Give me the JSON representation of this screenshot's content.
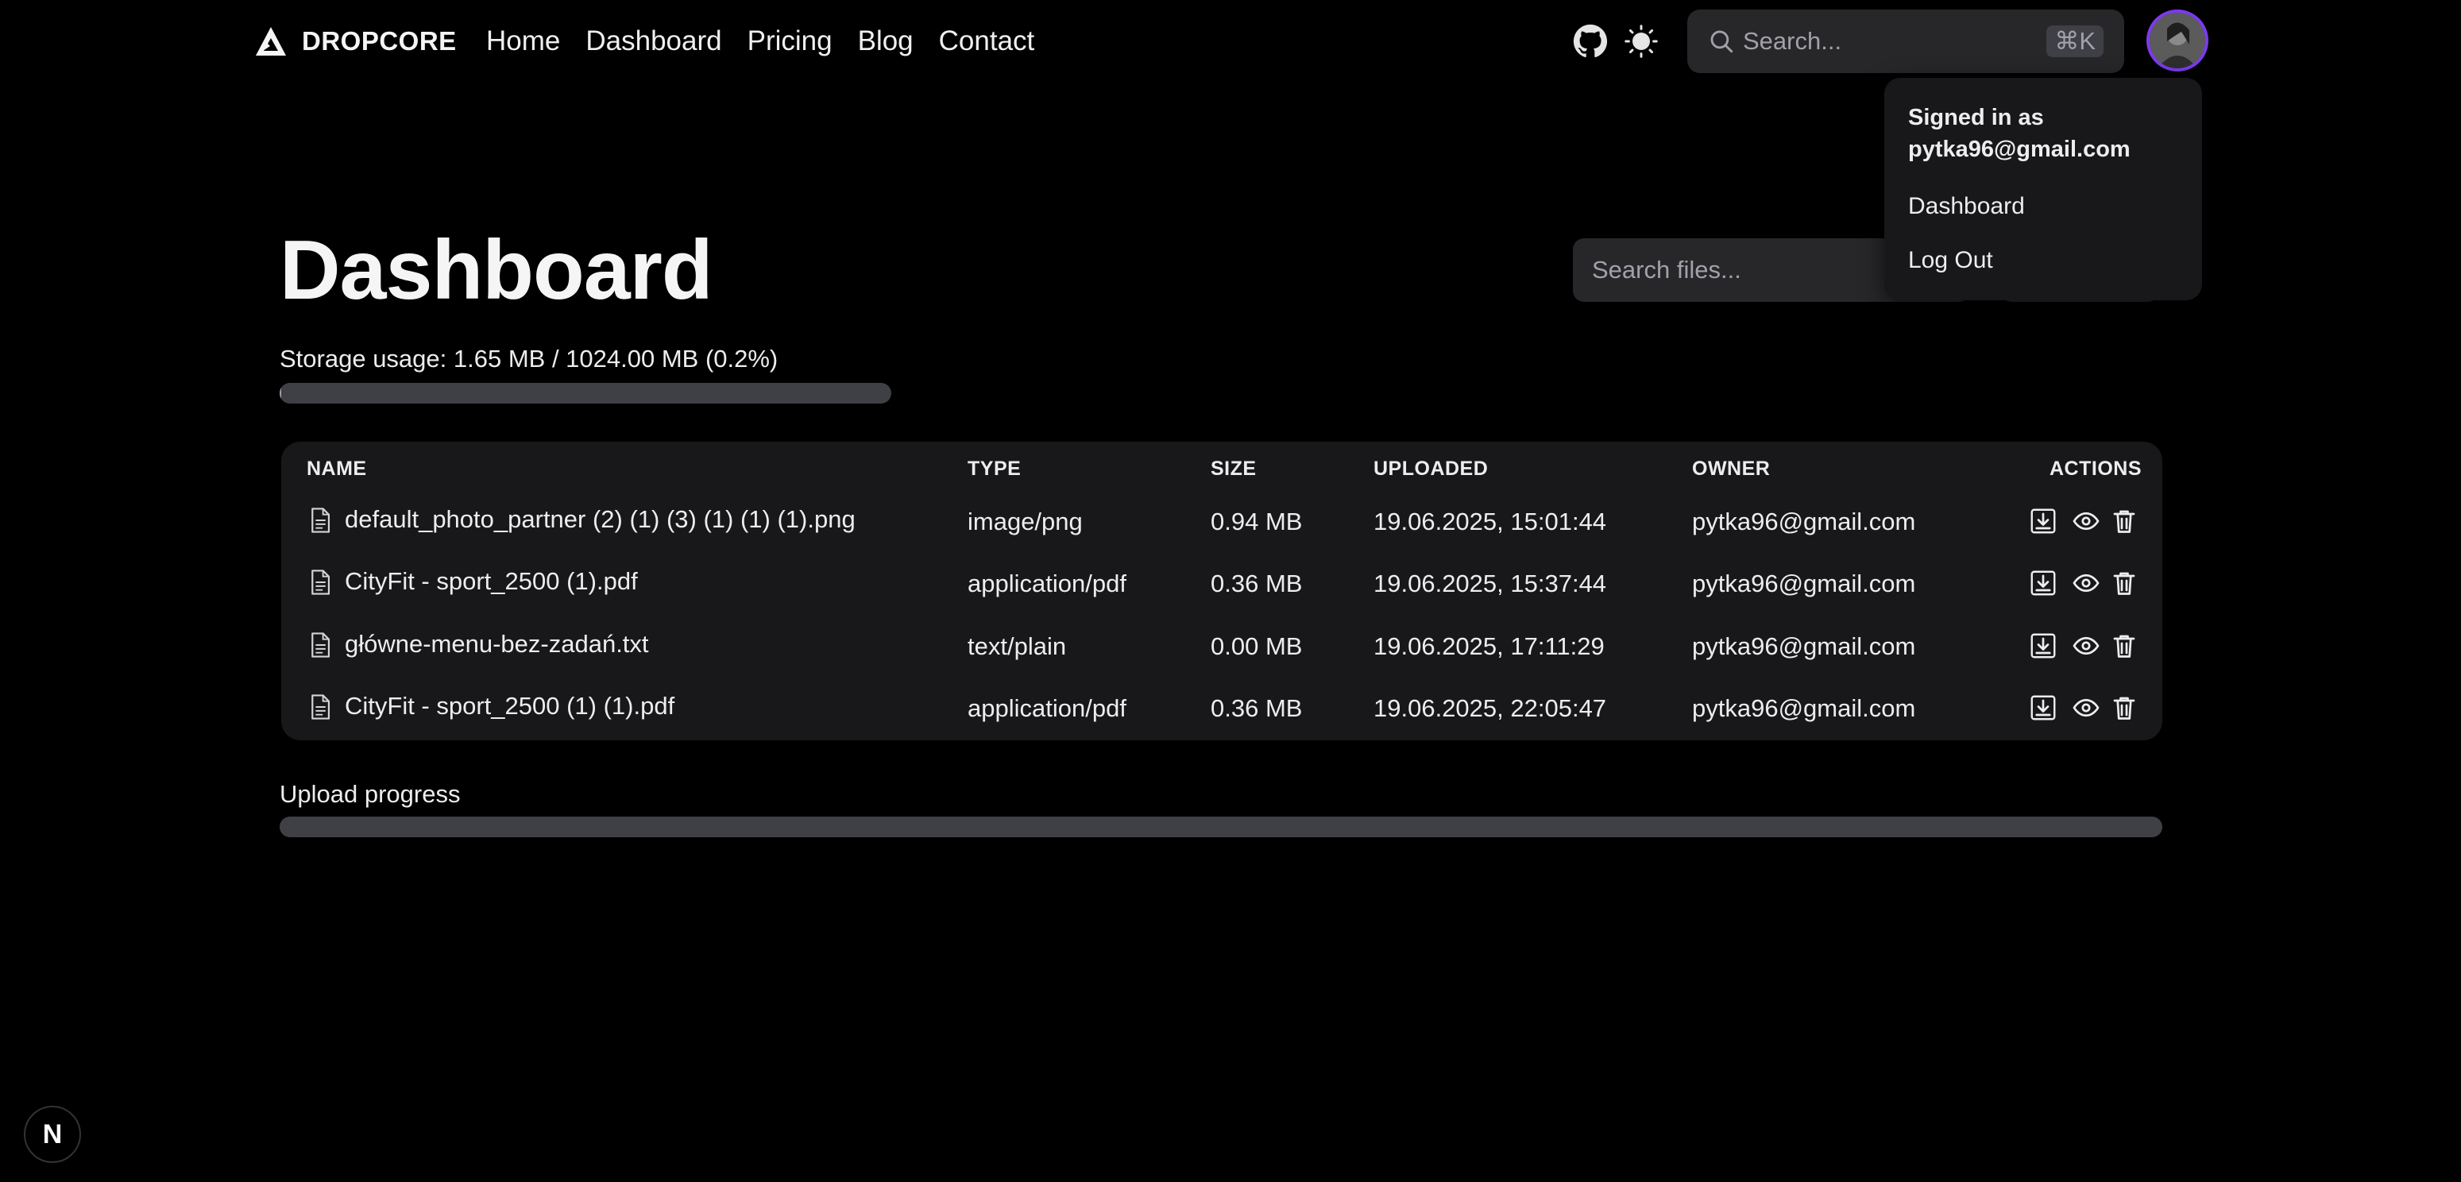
{
  "navbar": {
    "brand": "DROPCORE",
    "links": [
      {
        "label": "Home"
      },
      {
        "label": "Dashboard"
      },
      {
        "label": "Pricing"
      },
      {
        "label": "Blog"
      },
      {
        "label": "Contact"
      }
    ],
    "search_placeholder": "Search...",
    "search_shortcut": "⌘K"
  },
  "user_menu": {
    "signed_in_label": "Signed in as",
    "email": "pytka96@gmail.com",
    "items": [
      {
        "label": "Dashboard"
      },
      {
        "label": "Log Out"
      }
    ]
  },
  "page": {
    "title": "Dashboard",
    "files_search_placeholder": "Search files...",
    "storage_label": "Storage usage: 1.65 MB / 1024.00 MB (0.2%)",
    "storage_fraction": 0.002,
    "upload_label": "Upload progress",
    "upload_fraction": 0
  },
  "table": {
    "headers": [
      "NAME",
      "TYPE",
      "SIZE",
      "UPLOADED",
      "OWNER",
      "ACTIONS"
    ],
    "rows": [
      {
        "name": "default_photo_partner (2) (1) (3) (1) (1) (1).png",
        "type": "image/png",
        "size": "0.94 MB",
        "uploaded": "19.06.2025, 15:01:44",
        "owner": "pytka96@gmail.com"
      },
      {
        "name": "CityFit - sport_2500 (1).pdf",
        "type": "application/pdf",
        "size": "0.36 MB",
        "uploaded": "19.06.2025, 15:37:44",
        "owner": "pytka96@gmail.com"
      },
      {
        "name": "główne-menu-bez-zadań.txt",
        "type": "text/plain",
        "size": "0.00 MB",
        "uploaded": "19.06.2025, 17:11:29",
        "owner": "pytka96@gmail.com"
      },
      {
        "name": "CityFit - sport_2500 (1) (1).pdf",
        "type": "application/pdf",
        "size": "0.36 MB",
        "uploaded": "19.06.2025, 22:05:47",
        "owner": "pytka96@gmail.com"
      }
    ],
    "action_icons": [
      "download-icon",
      "eye-icon",
      "trash-icon"
    ]
  },
  "badge": {
    "label": "N"
  },
  "colors": {
    "background": "#000000",
    "surface": "#18181b",
    "input": "#27272a",
    "avatar_ring": "#7c3aed",
    "text": "#ededed",
    "muted": "#a1a1aa"
  }
}
